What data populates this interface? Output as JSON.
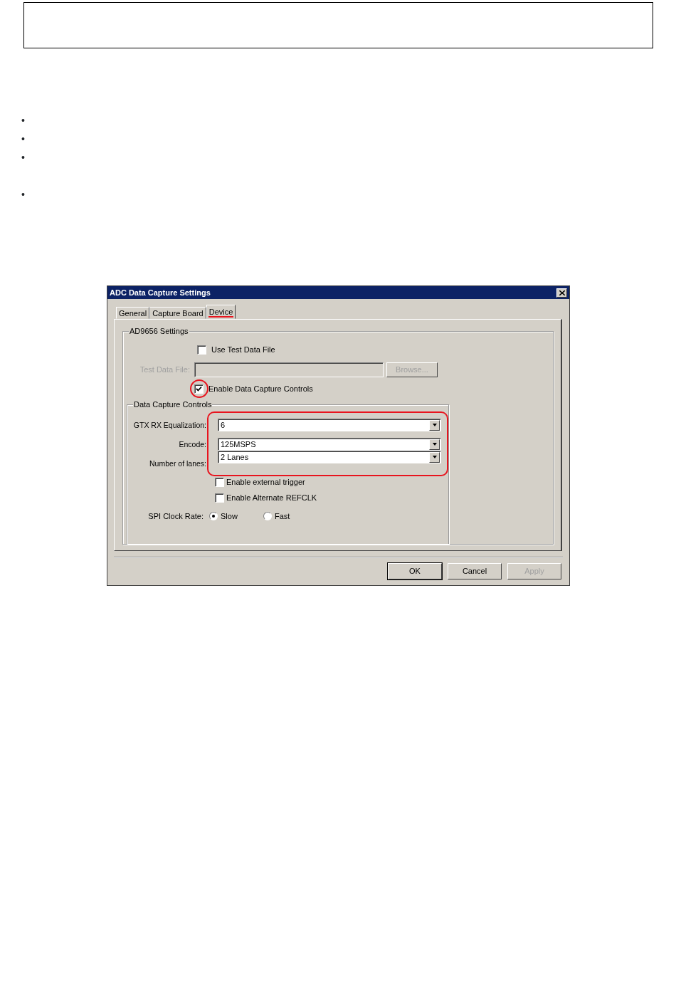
{
  "bullets": [
    "•",
    "•",
    "•",
    "•"
  ],
  "dialog": {
    "title": "ADC Data Capture Settings",
    "tabs": [
      {
        "label": "General",
        "selected": false,
        "highlighted": false
      },
      {
        "label": "Capture Board",
        "selected": false,
        "highlighted": false
      },
      {
        "label": "Device",
        "selected": true,
        "highlighted": true
      }
    ],
    "settings_group": {
      "title": "AD9656 Settings",
      "use_test_data_file": {
        "label": "Use Test Data File",
        "checked": false
      },
      "test_data_file": {
        "label": "Test Data File:",
        "disabled": true
      },
      "browse_button": {
        "label": "Browse...",
        "disabled": true
      },
      "enable_controls": {
        "label": "Enable Data Capture Controls",
        "checked": true,
        "highlighted": true
      }
    },
    "capture_group": {
      "title": "Data Capture Controls",
      "highlighted": true,
      "combos": [
        {
          "label": "GTX RX Equalization:",
          "value": "6"
        },
        {
          "label": "Encode:",
          "value": "125MSPS"
        },
        {
          "label": "Number of lanes:",
          "value": "2 Lanes"
        }
      ],
      "checkboxes": [
        {
          "label": "Enable external trigger",
          "checked": false
        },
        {
          "label": "Enable Alternate REFCLK",
          "checked": false
        }
      ],
      "spi": {
        "label": "SPI Clock Rate:",
        "options": [
          {
            "label": "Slow",
            "selected": true
          },
          {
            "label": "Fast",
            "selected": false
          }
        ]
      }
    },
    "buttons": [
      {
        "label": "OK",
        "default": true,
        "disabled": false
      },
      {
        "label": "Cancel",
        "default": false,
        "disabled": false
      },
      {
        "label": "Apply",
        "default": false,
        "disabled": true
      }
    ]
  }
}
